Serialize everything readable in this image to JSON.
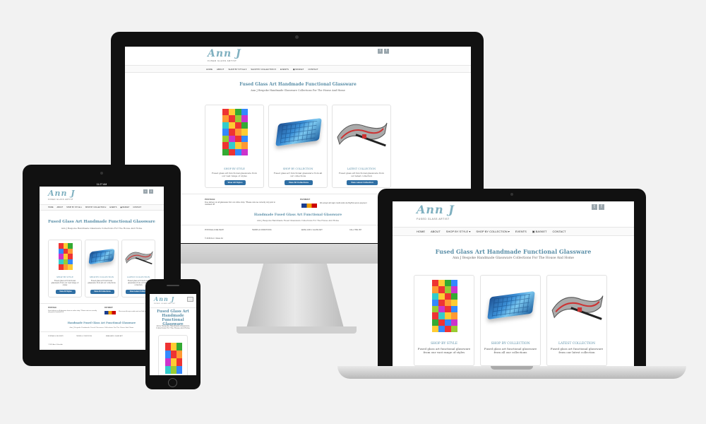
{
  "site": {
    "logo": "Ann J",
    "tagline": "FUSED GLASS ARTIST",
    "social": [
      "t",
      "f"
    ],
    "nav": [
      "HOME",
      "ABOUT",
      "SHOP BY STYLE ▾",
      "SHOP BY COLLECTION ▾",
      "EVENTS",
      "▣ BASKET",
      "CONTACT"
    ],
    "title": "Fused Glass Art Handmade Functional Glassware",
    "subtitle": "Ann J Bespoke Handmade Glassware Collections For The House And Home",
    "cards": [
      {
        "title": "SHOP BY STYLE",
        "desc": "Fused glass art functional glassware from our vast range of styles",
        "button": "View All Styles"
      },
      {
        "title": "SHOP BY COLLECTION",
        "desc": "Fused glass art functional glassware from all our collections",
        "button": "View All Collections"
      },
      {
        "title": "LATEST COLLECTION",
        "desc": "Fused glass art functional glassware from our latest collection",
        "button": "View Latest Collection"
      }
    ],
    "postage_label": "POSTAGE",
    "postage_text": "Free delivery on all glassware from our online shop. *Please note we currently only post to mainland UK",
    "payment_label": "PAYMENT",
    "payment_text": "We accept all major credit cards via PayPal secure payment",
    "footer_title": "Handmade Fused Glass Art Functional Glassware",
    "footer_sub": "Ann J Bespoke Handmade Fused Glassware Collections For The House And Home",
    "footer_links": [
      "POSTAGE & DELIVERY",
      "TERMS & CONDITIONS",
      "EMAIL ANN J GLASS ART",
      "CALL 7891 957"
    ],
    "copyright": "© 2015 Ann J Glass Art"
  },
  "tablet_status": {
    "time": "11:27 AM"
  },
  "colors": {
    "accent": "#5b8fa8",
    "button": "#2f6fa4",
    "logo": "#7fb0c0"
  }
}
